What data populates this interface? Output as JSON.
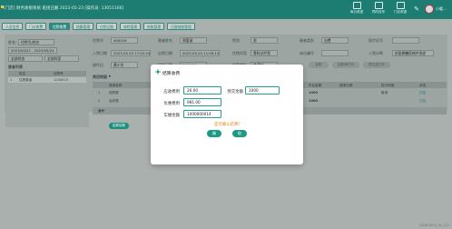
{
  "topbar": {
    "title": "[门店]  财务收银系统    班组已删    2023-05-23    [操作员: 13051166]",
    "items": [
      {
        "label": "每日收银",
        "icon": "register-icon"
      },
      {
        "label": "预约挂号",
        "icon": "calendar-icon"
      },
      {
        "label": "门店收银",
        "icon": "store-icon"
      }
    ],
    "user": "小暖..."
  },
  "tabs": [
    "人员信息",
    "门诊收费",
    "住院收费",
    "结算管理",
    "住院记账",
    "体检管理",
    "结账管理",
    "日报结账管理"
  ],
  "left": {
    "search_label": "姓名：",
    "search_placeholder": "住院号/姓名",
    "date_range": "2023/05/22 - 2023/05/24",
    "filters": [
      "全部状态",
      "全部科室"
    ],
    "list_title": "患者列表",
    "list_headers": [
      "",
      "姓名",
      "住院号"
    ],
    "list_row": [
      "1",
      "住院患者",
      "1234515"
    ]
  },
  "info": {
    "row1": [
      {
        "label": "住院号",
        "value": "400016"
      },
      {
        "label": "患者姓名",
        "value": "郑爱丽"
      },
      {
        "label": "性别",
        "value": "男"
      },
      {
        "label": "患者类别",
        "value": "自费"
      },
      {
        "label": "医疗证号",
        "value": ""
      }
    ],
    "row2": [
      {
        "label": "入院日期",
        "value": "2023-05-23 17:02:24"
      },
      {
        "label": "出院日期",
        "value": "2023-05-24 11:09:12"
      },
      {
        "label": "住院科室",
        "value": "骨科诊疗室"
      },
      {
        "label": "床位编号",
        "value": ""
      },
      {
        "label": "入院诊断",
        "value": "妊娠期糖尿病并发症"
      }
    ],
    "row3": [
      {
        "label": "操作员",
        "value": "黄小华"
      },
      {
        "label": "结账日期",
        "value": "2023-05"
      },
      {
        "label": "结算类别",
        "value": "普通结"
      }
    ],
    "buttons": [
      "挂账",
      "结账单打印",
      "预交金打印"
    ]
  },
  "table": {
    "title": "费用明细",
    "headers": [
      "费用名称",
      "规格",
      "单位",
      "数量",
      "单价",
      "金额",
      "折后金额",
      "费用日期",
      "执行科室",
      "状态"
    ],
    "rows": [
      {
        "no": "1",
        "name": "西药费",
        "amount": "1000",
        "dept": "取消",
        "status": "已结"
      },
      {
        "no": "2",
        "name": "治疗费",
        "amount": "1000",
        "dept": "",
        "status": "已结"
      }
    ],
    "total_label": "合计",
    "settle_label": "结算结账"
  },
  "modal": {
    "title": "结算收费",
    "fields": [
      {
        "label": "应收费用",
        "value": "26.00"
      },
      {
        "label": "预交金额",
        "value": "1000"
      },
      {
        "label": "优惠费用",
        "value": "981.00"
      },
      {
        "label": "实缴金额",
        "value": "1000000014"
      }
    ],
    "hint": "是否确认结算？",
    "ok_label": "确",
    "cancel_label": "取"
  },
  "watermark": "CSDN @Hu_Ya_123"
}
